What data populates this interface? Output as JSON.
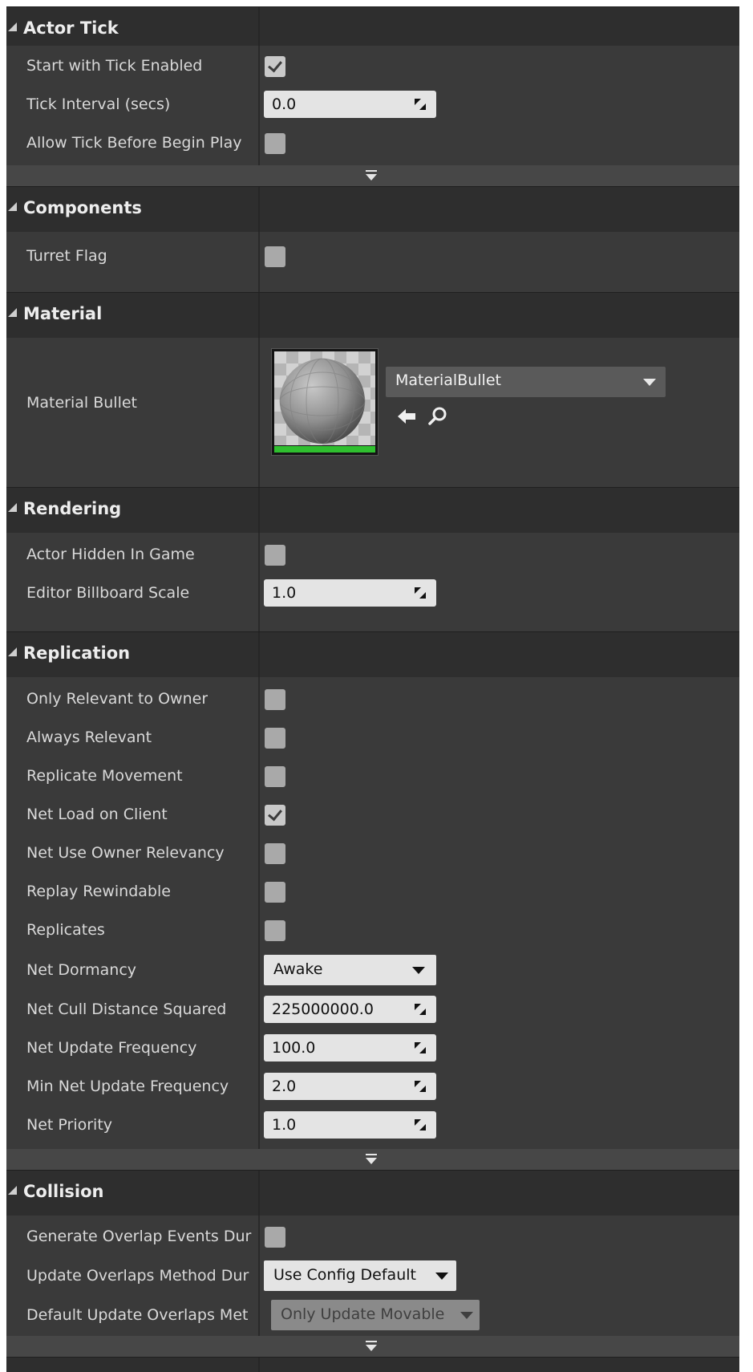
{
  "categories": {
    "actor_tick": "Actor Tick",
    "components": "Components",
    "material": "Material",
    "rendering": "Rendering",
    "replication": "Replication",
    "collision": "Collision"
  },
  "actor_tick": {
    "start_with_tick_enabled": {
      "label": "Start with Tick Enabled",
      "checked": true
    },
    "tick_interval": {
      "label": "Tick Interval (secs)",
      "value": "0.0"
    },
    "allow_tick_before_begin_play": {
      "label": "Allow Tick Before Begin Play",
      "checked": false
    }
  },
  "components": {
    "turret_flag": {
      "label": "Turret Flag",
      "checked": false
    }
  },
  "material": {
    "material_bullet": {
      "label": "Material Bullet",
      "asset": "MaterialBullet"
    }
  },
  "rendering": {
    "actor_hidden_in_game": {
      "label": "Actor Hidden In Game",
      "checked": false
    },
    "editor_billboard_scale": {
      "label": "Editor Billboard Scale",
      "value": "1.0"
    }
  },
  "replication": {
    "only_relevant_to_owner": {
      "label": "Only Relevant to Owner",
      "checked": false
    },
    "always_relevant": {
      "label": "Always Relevant",
      "checked": false
    },
    "replicate_movement": {
      "label": "Replicate Movement",
      "checked": false
    },
    "net_load_on_client": {
      "label": "Net Load on Client",
      "checked": true
    },
    "net_use_owner_relevancy": {
      "label": "Net Use Owner Relevancy",
      "checked": false
    },
    "replay_rewindable": {
      "label": "Replay Rewindable",
      "checked": false
    },
    "replicates": {
      "label": "Replicates",
      "checked": false
    },
    "net_dormancy": {
      "label": "Net Dormancy",
      "value": "Awake"
    },
    "net_cull_distance_squared": {
      "label": "Net Cull Distance Squared",
      "value": "225000000.0"
    },
    "net_update_frequency": {
      "label": "Net Update Frequency",
      "value": "100.0"
    },
    "min_net_update_frequency": {
      "label": "Min Net Update Frequency",
      "value": "2.0"
    },
    "net_priority": {
      "label": "Net Priority",
      "value": "1.0"
    }
  },
  "collision": {
    "generate_overlap_events": {
      "label": "Generate Overlap Events Dur",
      "checked": false
    },
    "update_overlaps_method": {
      "label": "Update Overlaps Method Dur",
      "value": "Use Config Default"
    },
    "default_update_overlaps_method": {
      "label": "Default Update Overlaps Met",
      "value": "Only Update Movable",
      "disabled": true
    }
  },
  "icons": {
    "category_toggle": "collapse-triangle-icon",
    "advanced": "advanced-expander-icon",
    "spin": "drag-spin-icon",
    "use_selected": "arrow-left-icon",
    "browse": "magnifier-icon",
    "checkmark": "checkmark-icon"
  },
  "colors": {
    "panel_bg": "#3a3a3a",
    "category_bg": "#2e2e2e",
    "field_bg": "#e4e4e4",
    "checkbox": "#a9a9a9",
    "thumbnail_bar": "#2fbf2f"
  }
}
